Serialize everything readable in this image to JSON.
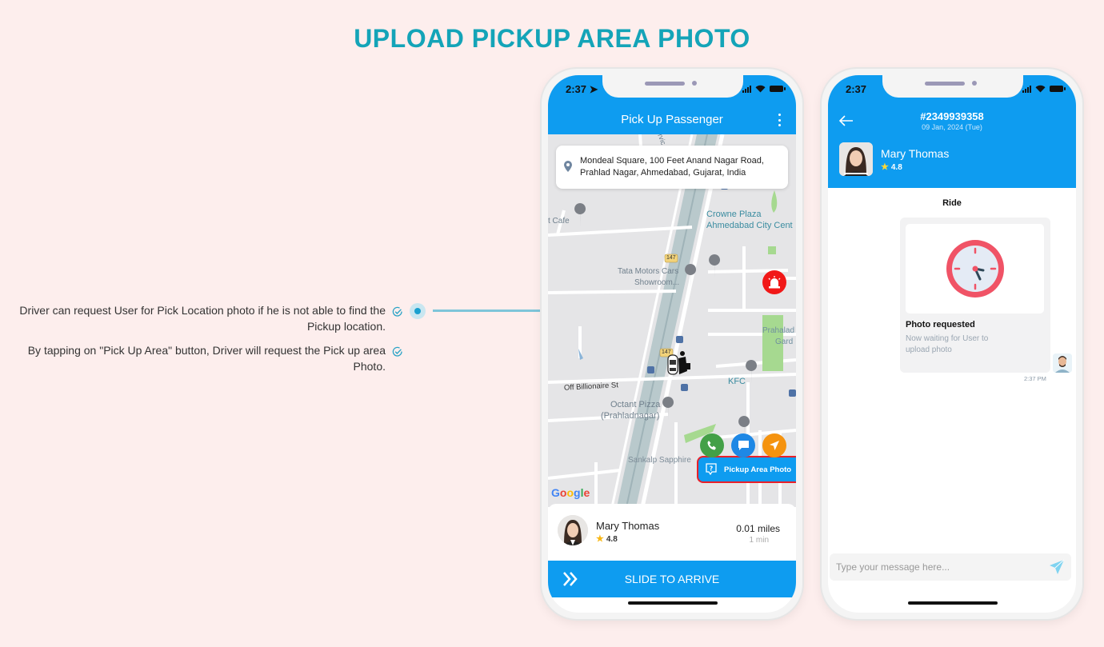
{
  "page": {
    "title": "UPLOAD PICKUP AREA PHOTO",
    "features": [
      "Driver can request User for Pick Location photo if he is not able to find the Pickup location.",
      "By tapping on \"Pick Up Area\" button, Driver will request the Pick up area Photo."
    ]
  },
  "colors": {
    "accent": "#14a4b8",
    "primary_blue": "#0e9cf0",
    "background": "#fdeeed",
    "sos_red": "#f11818",
    "call_green": "#43a047",
    "chat_blue": "#1e88e5",
    "navigate_orange": "#f5930f",
    "star_gold": "#f8b716"
  },
  "driver_screen": {
    "status_time": "2:37",
    "app_bar_title": "Pick Up Passenger",
    "menu_icon": "kebab-menu-icon",
    "pickup_address_line1": "Mondeal Square, 100 Feet Anand Nagar Road,",
    "pickup_address_line2": "Prahlad Nagar, Ahmedabad, Gujarat, India",
    "map_labels": {
      "crowne_plaza_1": "Crowne Plaza",
      "crowne_plaza_2": "Ahmedabad City Cent",
      "cafe": "t Cafe",
      "tata_1": "Tata Motors Cars",
      "tata_2": "Showroom...",
      "highway": "147",
      "billionaire": "Off Billionaire St",
      "kfc": "KFC",
      "octant_1": "Octant Pizza",
      "octant_2": "(Prahladnagar)",
      "prahalad_1": "Prahalad",
      "prahalad_2": "Gard",
      "sankalp": "Sankalp Sapphire",
      "service_road": "Servic"
    },
    "pickup_area_button": "Pickup Area Photo",
    "google_logo": "Google",
    "rider": {
      "name": "Mary Thomas",
      "rating": "4.8",
      "distance": "0.01 miles",
      "eta": "1 min"
    },
    "slide_label": "SLIDE TO ARRIVE"
  },
  "chat_screen": {
    "status_time": "2:37",
    "order_id": "#2349939358",
    "order_date": "09 Jan, 2024 (Tue)",
    "rider_name": "Mary Thomas",
    "rider_rating": "4.8",
    "section_title": "Ride",
    "message": {
      "title": "Photo requested",
      "subtitle": "Now waiting for User to upload photo",
      "time": "2:37 PM"
    },
    "input_placeholder": "Type your message here..."
  }
}
